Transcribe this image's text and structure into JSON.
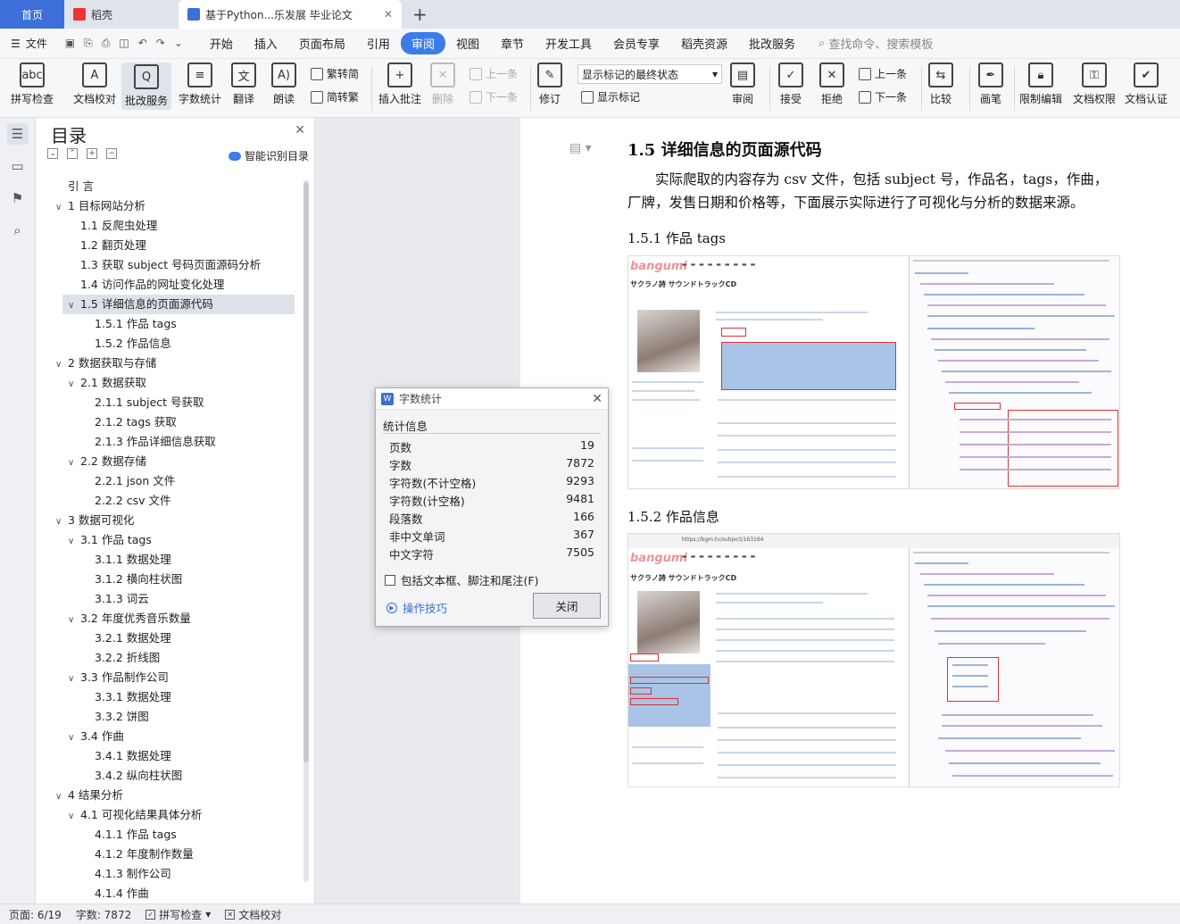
{
  "tabs": {
    "home": "首页",
    "wps": "稻壳",
    "doc": "基于Python...乐发展 毕业论文"
  },
  "menu": {
    "file": "文件",
    "items": [
      "开始",
      "插入",
      "页面布局",
      "引用",
      "审阅",
      "视图",
      "章节",
      "开发工具",
      "会员专享",
      "稻壳资源",
      "批改服务"
    ],
    "active": "审阅",
    "search": "查找命令、搜索模板"
  },
  "ribbon": {
    "spell": "拼写检查",
    "proof": "文档校对",
    "correct": "批改服务",
    "wordcount": "字数统计",
    "translate": "翻译",
    "read": "朗读",
    "simp2trad": "繁转简",
    "trad2simp": "简转繁",
    "insert_comment": "插入批注",
    "delete": "删除",
    "prev": "上一条",
    "next": "下一条",
    "revise": "修订",
    "markup_select": "显示标记的最终状态",
    "show_markup": "显示标记",
    "review": "审阅",
    "accept": "接受",
    "reject": "拒绝",
    "prev2": "上一条",
    "next2": "下一条",
    "compare": "比较",
    "ink": "画笔",
    "restrict": "限制编辑",
    "rights": "文档权限",
    "certify": "文档认证"
  },
  "nav": {
    "title": "目录",
    "smart": "智能识别目录",
    "items": [
      {
        "label": "引    言",
        "level": 0,
        "arrow": ""
      },
      {
        "label": "1   目标网站分析",
        "level": 0,
        "arrow": "∨"
      },
      {
        "label": "1.1   反爬虫处理",
        "level": 1,
        "arrow": ""
      },
      {
        "label": "1.2   翻页处理",
        "level": 1,
        "arrow": ""
      },
      {
        "label": "1.3   获取 subject 号码页面源码分析",
        "level": 1,
        "arrow": ""
      },
      {
        "label": "1.4  访问作品的网址变化处理",
        "level": 1,
        "arrow": ""
      },
      {
        "label": "1.5  详细信息的页面源代码",
        "level": 1,
        "arrow": "∨",
        "selected": true
      },
      {
        "label": "1.5.1  作品 tags",
        "level": 2,
        "arrow": ""
      },
      {
        "label": "1.5.2  作品信息",
        "level": 2,
        "arrow": ""
      },
      {
        "label": "2   数据获取与存储",
        "level": 0,
        "arrow": "∨"
      },
      {
        "label": "2.1 数据获取",
        "level": 1,
        "arrow": "∨"
      },
      {
        "label": "2.1.1 subject 号获取",
        "level": 2,
        "arrow": ""
      },
      {
        "label": "2.1.2 tags 获取",
        "level": 2,
        "arrow": ""
      },
      {
        "label": "2.1.3  作品详细信息获取",
        "level": 2,
        "arrow": ""
      },
      {
        "label": "2.2 数据存储",
        "level": 1,
        "arrow": "∨"
      },
      {
        "label": "2.2.1 json 文件",
        "level": 2,
        "arrow": ""
      },
      {
        "label": "2.2.2 csv 文件",
        "level": 2,
        "arrow": ""
      },
      {
        "label": "3   数据可视化",
        "level": 0,
        "arrow": "∨"
      },
      {
        "label": "3.1 作品 tags",
        "level": 1,
        "arrow": "∨"
      },
      {
        "label": "3.1.1  数据处理",
        "level": 2,
        "arrow": ""
      },
      {
        "label": "3.1.2  横向柱状图",
        "level": 2,
        "arrow": ""
      },
      {
        "label": "3.1.3  词云",
        "level": 2,
        "arrow": ""
      },
      {
        "label": "3.2  年度优秀音乐数量",
        "level": 1,
        "arrow": "∨"
      },
      {
        "label": "3.2.1  数据处理",
        "level": 2,
        "arrow": ""
      },
      {
        "label": "3.2.2  折线图",
        "level": 2,
        "arrow": ""
      },
      {
        "label": "3.3 作品制作公司",
        "level": 1,
        "arrow": "∨"
      },
      {
        "label": "3.3.1  数据处理",
        "level": 2,
        "arrow": ""
      },
      {
        "label": "3.3.2  饼图",
        "level": 2,
        "arrow": ""
      },
      {
        "label": "3.4 作曲",
        "level": 1,
        "arrow": "∨"
      },
      {
        "label": "3.4.1  数据处理",
        "level": 2,
        "arrow": ""
      },
      {
        "label": "3.4.2  纵向柱状图",
        "level": 2,
        "arrow": ""
      },
      {
        "label": "4   结果分析",
        "level": 0,
        "arrow": "∨"
      },
      {
        "label": "4.1  可视化结果具体分析",
        "level": 1,
        "arrow": "∨"
      },
      {
        "label": "4.1.1 作品 tags",
        "level": 2,
        "arrow": ""
      },
      {
        "label": "4.1.2  年度制作数量",
        "level": 2,
        "arrow": ""
      },
      {
        "label": "4.1.3  制作公司",
        "level": 2,
        "arrow": ""
      },
      {
        "label": "4.1.4  作曲",
        "level": 2,
        "arrow": ""
      }
    ]
  },
  "doc": {
    "h2": "1.5  详细信息的页面源代码",
    "para": "实际爬取的内容存为 csv 文件，包括 subject 号，作品名，tags，作曲，厂牌，发售日期和价格等，下面展示实际进行了可视化与分析的数据来源。",
    "h3a": "1.5.1  作品 tags",
    "h3b": "1.5.2  作品信息",
    "shot_logo": "bangumi",
    "shot_title": "サクラノ詩 サウンドトラックCD",
    "shot_url": "https://bgm.tv/subject/163164"
  },
  "dialog": {
    "title": "字数统计",
    "section": "统计信息",
    "rows": [
      {
        "label": "页数",
        "value": "19"
      },
      {
        "label": "字数",
        "value": "7872"
      },
      {
        "label": "字符数(不计空格)",
        "value": "9293"
      },
      {
        "label": "字符数(计空格)",
        "value": "9481"
      },
      {
        "label": "段落数",
        "value": "166"
      },
      {
        "label": "非中文单词",
        "value": "367"
      },
      {
        "label": "中文字符",
        "value": "7505"
      }
    ],
    "checkbox": "包括文本框、脚注和尾注(F)",
    "tips": "操作技巧",
    "close": "关闭"
  },
  "status": {
    "page": "页面: 6/19",
    "words": "字数: 7872",
    "spell": "拼写检查",
    "proof": "文档校对"
  }
}
